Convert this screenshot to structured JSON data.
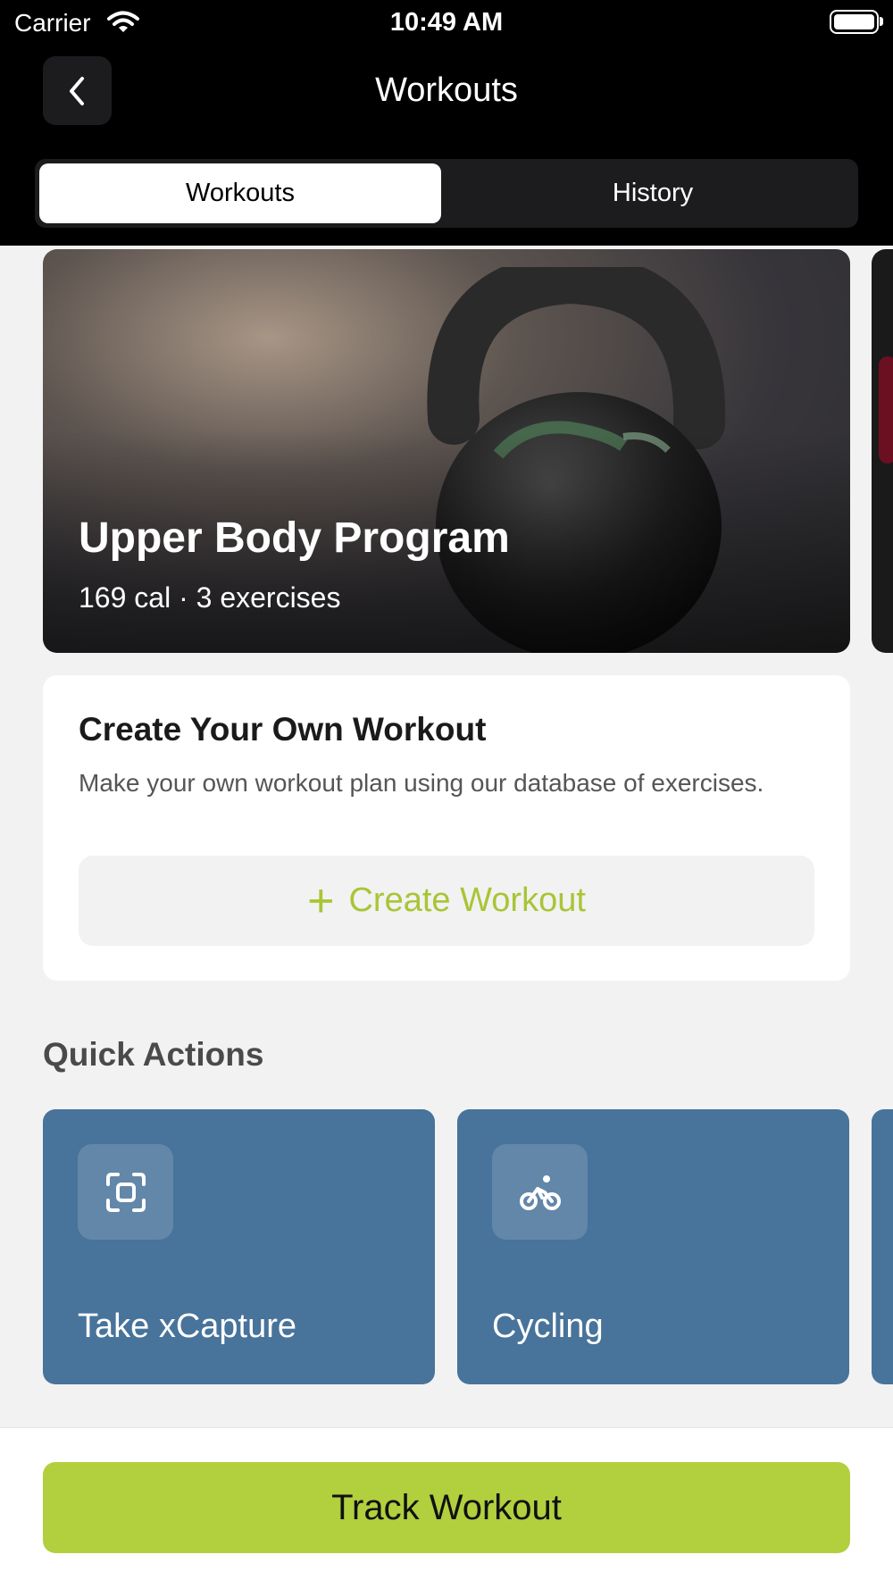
{
  "status_bar": {
    "carrier": "Carrier",
    "time": "10:49 AM",
    "battery_level": 1.0
  },
  "nav": {
    "title": "Workouts",
    "back_icon": "chevron-left-icon"
  },
  "tabs": [
    {
      "label": "Workouts",
      "active": true
    },
    {
      "label": "History",
      "active": false
    }
  ],
  "featured": {
    "title": "Upper Body Program",
    "subtitle": "169 cal · 3 exercises"
  },
  "create_workout": {
    "title": "Create Your Own Workout",
    "description": "Make your own workout plan using our database of exercises.",
    "button_label": "Create Workout",
    "button_icon": "plus-icon"
  },
  "quick_actions": {
    "heading": "Quick Actions",
    "items": [
      {
        "label": "Take xCapture",
        "icon": "capture-icon"
      },
      {
        "label": "Cycling",
        "icon": "bicycle-icon"
      }
    ]
  },
  "footer": {
    "track_label": "Track Workout"
  },
  "colors": {
    "accent_green": "#b2cf3e",
    "accent_text_green": "#a8c536",
    "tile_blue": "#48739a",
    "header_black": "#000000"
  }
}
